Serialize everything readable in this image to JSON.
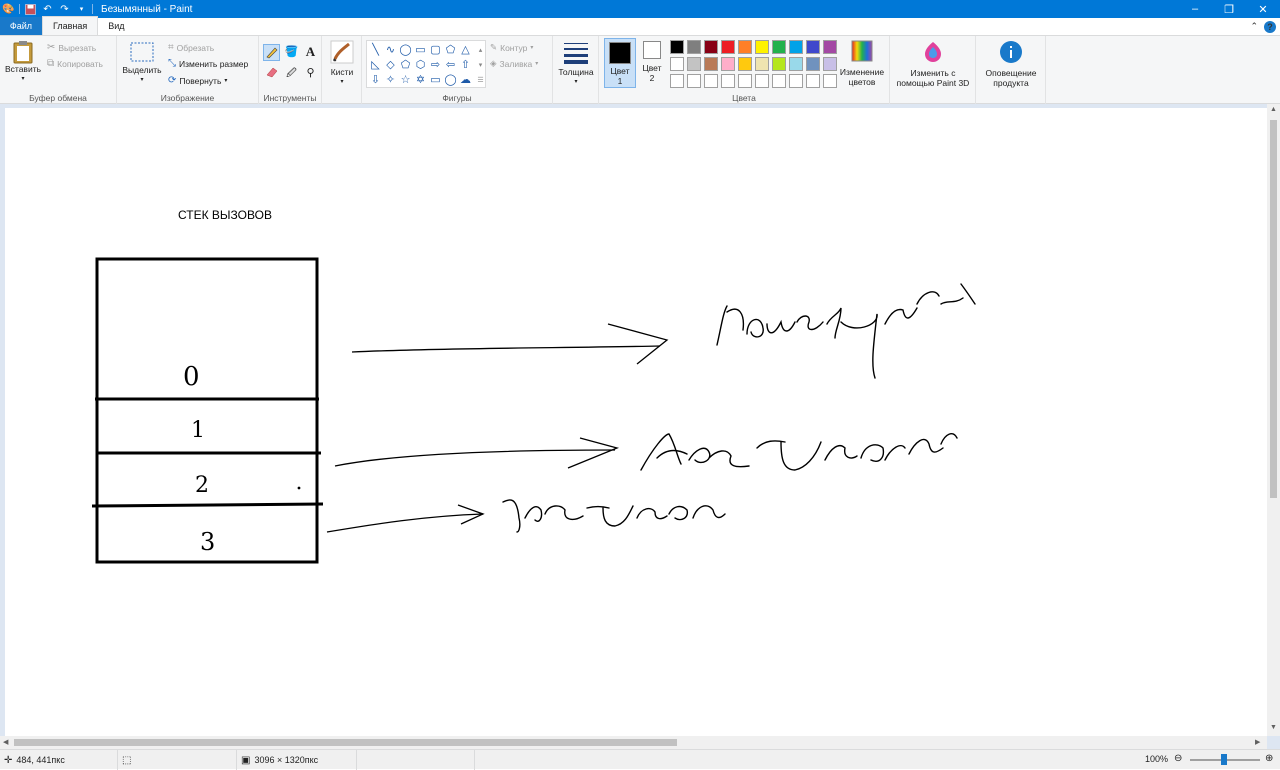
{
  "window": {
    "title": "Безымянный - Paint",
    "controls": [
      "–",
      "❐",
      "✕"
    ]
  },
  "quick_access": {
    "icons": [
      "paint-app-icon",
      "save-icon",
      "undo-icon",
      "redo-icon",
      "customize-icon"
    ]
  },
  "tabs": [
    {
      "label": "Файл"
    },
    {
      "label": "Главная"
    },
    {
      "label": "Вид"
    }
  ],
  "ribbon": {
    "clipboard": {
      "group_label": "Буфер обмена",
      "paste": "Вставить",
      "cut": "Вырезать",
      "copy": "Копировать"
    },
    "image": {
      "group_label": "Изображение",
      "select": "Выделить",
      "crop": "Обрезать",
      "resize": "Изменить размер",
      "rotate": "Повернуть"
    },
    "tools": {
      "group_label": "Инструменты"
    },
    "brushes": {
      "label": "Кисти"
    },
    "shapes": {
      "group_label": "Фигуры",
      "outline": "Контур",
      "fill": "Заливка"
    },
    "size": {
      "label": "Толщина"
    },
    "colors": {
      "group_label": "Цвета",
      "color1_line1": "Цвет",
      "color1_line2": "1",
      "color2_line1": "Цвет",
      "color2_line2": "2",
      "color1": "#000000",
      "color2": "#ffffff",
      "edit_line1": "Изменение",
      "edit_line2": "цветов",
      "palette_row1": [
        "#000000",
        "#7f7f7f",
        "#880015",
        "#ed1c24",
        "#ff7f27",
        "#fff200",
        "#22b14c",
        "#00a2e8",
        "#3f48cc",
        "#a349a4"
      ],
      "palette_row2": [
        "#ffffff",
        "#c3c3c3",
        "#b97a57",
        "#ffaec9",
        "#ffc90e",
        "#efe4b0",
        "#b5e61d",
        "#99d9ea",
        "#7092be",
        "#c8bfe7"
      ],
      "palette_row3": [
        "#ffffff",
        "#ffffff",
        "#ffffff",
        "#ffffff",
        "#ffffff",
        "#ffffff",
        "#ffffff",
        "#ffffff",
        "#ffffff",
        "#ffffff"
      ]
    },
    "paint3d": {
      "line1": "Изменить с",
      "line2": "помощью Paint 3D"
    },
    "alert": {
      "line1": "Оповещение",
      "line2": "продукта"
    }
  },
  "canvas": {
    "heading": "СТЕК ВЫЗОВОВ",
    "stack_digits": [
      "0",
      "1",
      "2",
      "3"
    ],
    "ink_color": "#000000"
  },
  "status": {
    "cursor_pos": "484, 441пкс",
    "image_size": "3096 × 1320пкс",
    "zoom": "100%"
  }
}
